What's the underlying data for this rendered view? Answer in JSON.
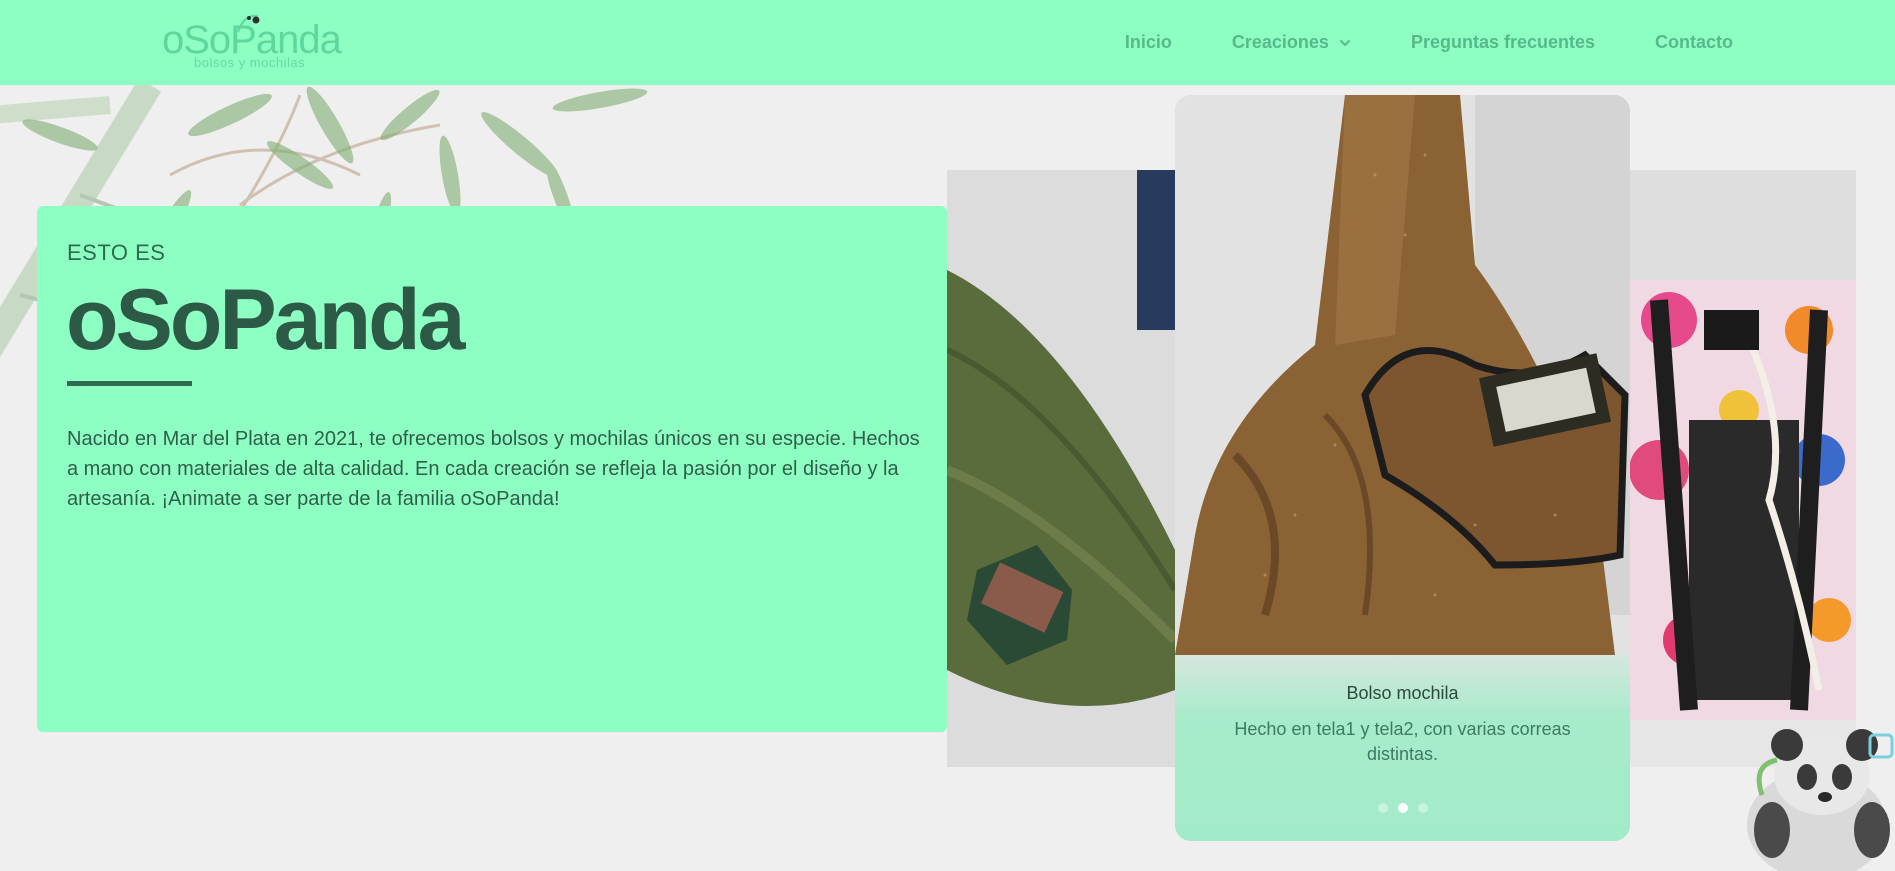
{
  "brand": {
    "name": "oSoPanda",
    "tagline": "bolsos y mochilas"
  },
  "nav": {
    "items": [
      {
        "label": "Inicio"
      },
      {
        "label": "Creaciones",
        "has_dropdown": true
      },
      {
        "label": "Preguntas frecuentes"
      },
      {
        "label": "Contacto"
      }
    ]
  },
  "hero": {
    "eyebrow": "ESTO ES",
    "title": "oSoPanda",
    "description": "Nacido en Mar del Plata en 2021, te ofrecemos bolsos y mochilas únicos en su especie. Hechos a mano con materiales de alta calidad. En cada creación se refleja la pasión por el diseño y la artesanía. ¡Animate a ser parte de la familia oSoPanda!"
  },
  "carousel": {
    "active_slide": {
      "title": "Bolso mochila",
      "text": "Hecho en tela1 y tela2, con varias correas distintas."
    },
    "dot_count": 3,
    "active_index": 1
  },
  "colors": {
    "accent": "#8effc3",
    "nav_text": "#57b98a",
    "dark_green": "#2d5a47",
    "background": "#efefef"
  }
}
